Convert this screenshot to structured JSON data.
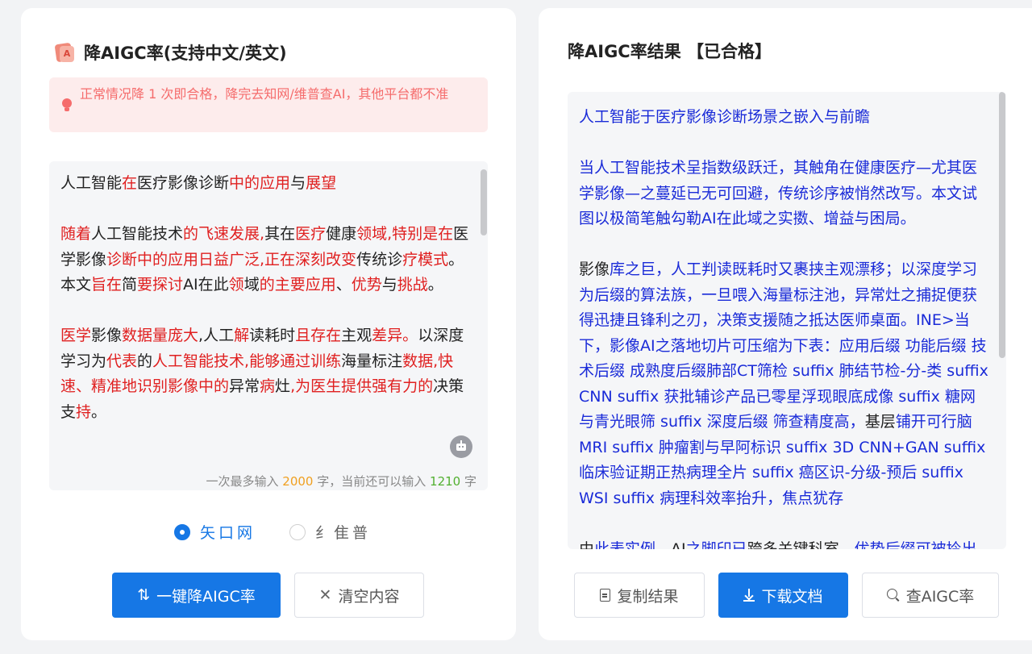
{
  "left_panel": {
    "title": "降AIGC率(支持中文/英文)",
    "notice": "正常情况降 1 次即合格，降完去知网/维普查AI，其他平台都不准",
    "editor": {
      "paragraphs": [
        [
          [
            "人工智能",
            0
          ],
          [
            "在",
            1
          ],
          [
            "医疗影像诊断",
            0
          ],
          [
            "中的应用",
            1
          ],
          [
            "与",
            0
          ],
          [
            "展望",
            1
          ]
        ],
        [
          [
            "随着",
            1
          ],
          [
            "人工智能技术",
            0
          ],
          [
            "的飞速发展,",
            1
          ],
          [
            "其在",
            0
          ],
          [
            "医疗",
            1
          ],
          [
            "健康",
            0
          ],
          [
            "领域,特别是在",
            1
          ],
          [
            "医学影像",
            0
          ],
          [
            "诊断中的应用日益广泛,正在深刻改变",
            1
          ],
          [
            "传统诊",
            0
          ],
          [
            "疗模式",
            1
          ],
          [
            "。本文",
            0
          ],
          [
            "旨在",
            1
          ],
          [
            "简",
            0
          ],
          [
            "要探讨",
            1
          ],
          [
            "AI在此",
            0
          ],
          [
            "领",
            1
          ],
          [
            "域",
            0
          ],
          [
            "的主要应用",
            1
          ],
          [
            "、",
            0
          ],
          [
            "优势",
            1
          ],
          [
            "与",
            0
          ],
          [
            "挑战",
            1
          ],
          [
            "。",
            0
          ]
        ],
        [
          [
            "医学",
            1
          ],
          [
            "影像",
            0
          ],
          [
            "数据量庞大",
            1
          ],
          [
            ",人工",
            0
          ],
          [
            "解",
            1
          ],
          [
            "读耗时",
            0
          ],
          [
            "且存在",
            1
          ],
          [
            "主观",
            0
          ],
          [
            "差异",
            1
          ],
          [
            "。",
            1
          ],
          [
            "以深度学习为",
            0
          ],
          [
            "代表",
            1
          ],
          [
            "的",
            0
          ],
          [
            "人工智能技术,能够通过训练",
            1
          ],
          [
            "海量标注",
            0
          ],
          [
            "数据,快速、精准地识别影像中的",
            1
          ],
          [
            "异常",
            0
          ],
          [
            "病",
            1
          ],
          [
            "灶",
            0
          ],
          [
            ",为医生提供强有力的",
            1
          ],
          [
            "决策支",
            0
          ],
          [
            "持",
            1
          ],
          [
            "。",
            0
          ]
        ]
      ],
      "counter_prefix": "一次最多输入 ",
      "max_chars": "2000",
      "counter_middle": " 字，当前还可以输入 ",
      "remaining_chars": "1210",
      "counter_suffix": " 字"
    },
    "platforms": [
      {
        "label": "矢口网",
        "checked": true
      },
      {
        "label": "纟隹普",
        "checked": false
      }
    ],
    "reduce_button": "一键降AIGC率",
    "clear_button": "清空内容"
  },
  "right_panel": {
    "title": "降AIGC率结果 【已合格】",
    "result": {
      "paragraphs": [
        [
          [
            "人工智能于医疗影像诊断场景之嵌入与前瞻",
            0
          ]
        ],
        [
          [
            "当人工智能技术呈指数级跃迁，其触角在健康医疗—尤其医学影像—之蔓延已无可回避，传统诊序被悄然改写。本文试图以极简笔触勾勒AI在此域之实擞、增益与困局。",
            0
          ]
        ],
        [
          [
            "影像",
            1
          ],
          [
            "库之巨，人工判读既耗时又裹挟主观漂移；以深度学习为后缀的算法族，一旦喂入海量标注池，异常灶之捕捉便获得迅捷且锋利之刃，决策支援随之抵达医师桌面。INE>当下，影像AI之落地切片可压缩为下表：应用后缀 功能后缀 技术后缀 成熟度后缀肺部CT筛检 suffix 肺结节检-分-类 suffix CNN suffix 获批辅诊产品已零星浮现眼底成像 suffix 糖网与青光眼筛 suffix 深度后缀 筛查精度高，",
            0
          ],
          [
            "基层",
            1
          ],
          [
            "铺开可行脑MRI suffix 肿瘤割与早阿标识 suffix 3D CNN+GAN suffix 临床验证期正热病理全片 suffix 癌区识-分级-预后 suffix WSI suffix 病理科效率抬升，焦点",
            0
          ],
          [
            "犹存",
            0
          ]
        ],
        [
          [
            "由",
            1
          ],
          [
            "此表实例，",
            0
          ],
          [
            "AI",
            1
          ],
          [
            "之脚印已",
            0
          ],
          [
            "跨多关键科室。",
            1
          ],
          [
            "优势后缀可被拎出三条：效率抬升，阅片时长被大幅压缩；一致性加固",
            0
          ]
        ]
      ]
    },
    "copy_button": "复制结果",
    "download_button": "下载文档",
    "check_button": "查AIGC率"
  },
  "colors": {
    "accent": "#1677e5",
    "highlight_red": "#e02020",
    "result_blue": "#1a2bd8",
    "notice_bg": "#fdecec",
    "notice_text": "#f56c6c"
  },
  "icons": {
    "logo": "aigc-logo-icon",
    "notice": "lightbulb-icon",
    "reduce": "swap-arrows-icon",
    "clear": "close-icon",
    "copy": "document-icon",
    "download": "download-icon",
    "check": "search-icon",
    "assistant": "robot-icon"
  }
}
